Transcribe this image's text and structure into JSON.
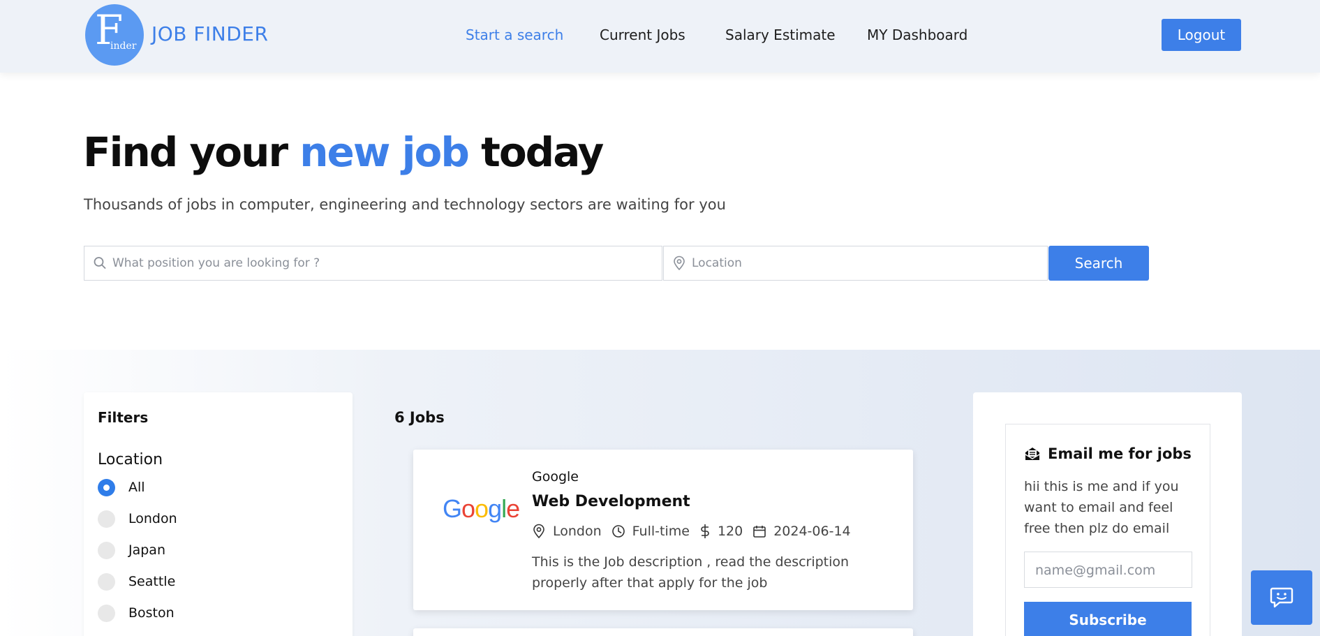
{
  "header": {
    "logo_letter": "F",
    "logo_small": "inder",
    "brand": "JOB FINDER",
    "nav": [
      "Start a search",
      "Current Jobs",
      "Salary Estimate",
      "MY Dashboard"
    ],
    "logout_label": "Logout",
    "accent_color": "#3d7fe8"
  },
  "hero": {
    "title_part1": "Find your ",
    "title_accent": "new job",
    "title_part2": " today",
    "subtitle": "Thousands of jobs in computer, engineering and technology sectors are waiting for you",
    "position_placeholder": "What position you are looking for ?",
    "location_placeholder": "Location",
    "search_label": "Search"
  },
  "filters": {
    "title": "Filters",
    "location_title": "Location",
    "options": [
      "All",
      "London",
      "Japan",
      "Seattle",
      "Boston"
    ],
    "selected": "All"
  },
  "jobs": {
    "count_label": "6 Jobs",
    "items": [
      {
        "company": "Google",
        "title": "Web Development",
        "location": "London",
        "type": "Full-time",
        "salary": "120",
        "date": "2024-06-14",
        "description": "This is the Job description , read the description properly after that apply for the job"
      }
    ]
  },
  "email_panel": {
    "title": "Email me for jobs",
    "text": "hii this is me and if you want to email and feel free then plz do email",
    "input_placeholder": "name@gmail.com",
    "subscribe_label": "Subscribe"
  },
  "icons": {
    "search": "search-icon",
    "location": "location-pin-icon",
    "clock": "clock-icon",
    "dollar": "dollar-icon",
    "calendar": "calendar-icon",
    "mail": "mail-icon",
    "chat": "chat-icon"
  }
}
